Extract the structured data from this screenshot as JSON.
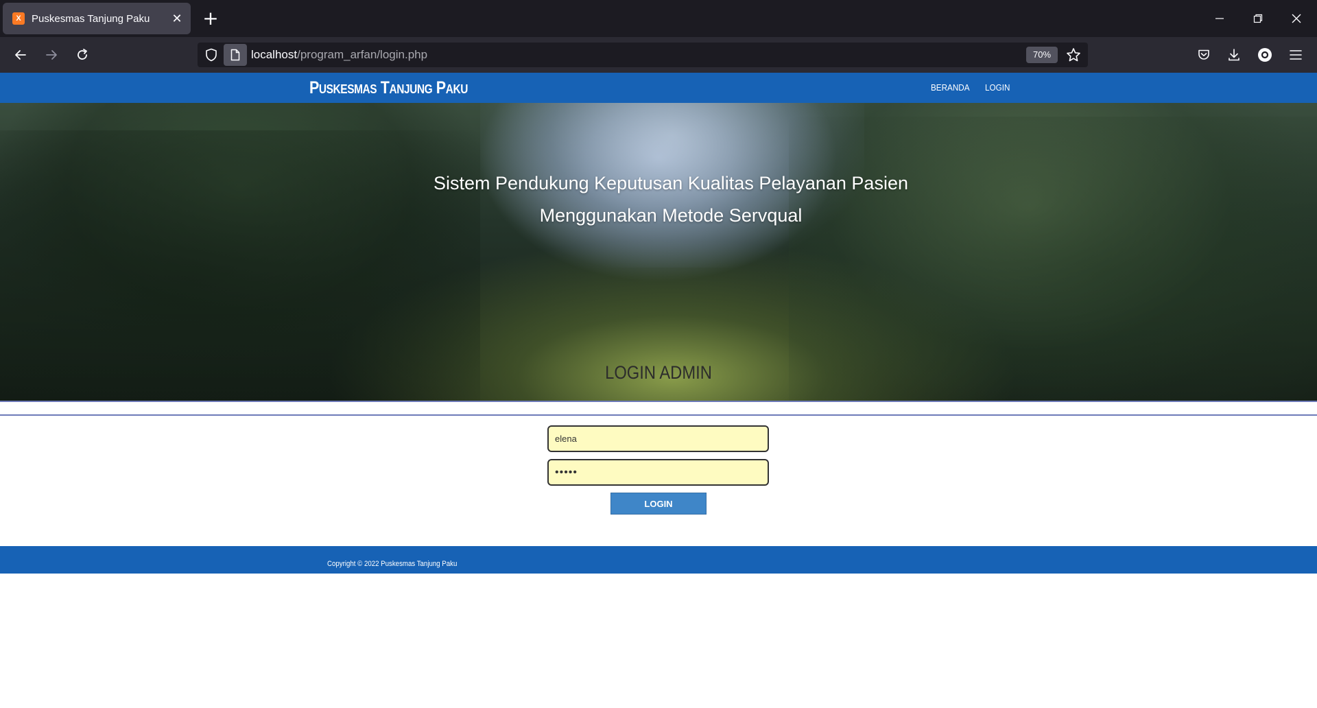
{
  "browser": {
    "tab_title": "Puskesmas Tanjung Paku",
    "url_host": "localhost",
    "url_path": "/program_arfan/login.php",
    "zoom": "70%",
    "favicon_letter": "X",
    "accent_color": "#fb7a24"
  },
  "header": {
    "brand": "Puskesmas Tanjung Paku",
    "menu": [
      {
        "label": "BERANDA"
      },
      {
        "label": "LOGIN"
      }
    ],
    "color": "#1762b5"
  },
  "hero": {
    "line1": "Sistem Pendukung Keputusan Kualitas Pelayanan Pasien",
    "line2": "Menggunakan Metode Servqual"
  },
  "login": {
    "title": "LOGIN ADMIN",
    "username_value": "elena",
    "password_mask": "•••••",
    "button_label": "LOGIN",
    "input_bg": "#fefbc1",
    "button_color": "#3f86c8"
  },
  "footer": {
    "copyright": "Copyright © 2022 Puskesmas Tanjung Paku"
  },
  "icons": {
    "back": "back-arrow-icon",
    "forward": "forward-arrow-icon",
    "reload": "reload-icon",
    "shield": "shield-icon",
    "page": "page-icon",
    "star": "bookmark-star-icon",
    "pocket": "pocket-icon",
    "download": "download-icon",
    "account": "account-icon",
    "menu": "hamburger-menu-icon"
  }
}
